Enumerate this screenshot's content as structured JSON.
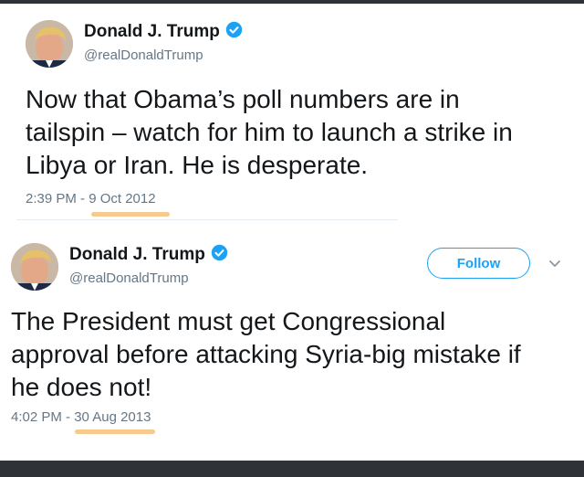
{
  "tweets": [
    {
      "author_name": "Donald J. Trump",
      "handle": "@realDonaldTrump",
      "text_lines": [
        "Now that Obama’s poll numbers are in",
        "tailspin – watch for him to launch a strike in",
        "Libya or Iran.  He is desperate."
      ],
      "timestamp": "2:39 PM - 9 Oct 2012"
    },
    {
      "author_name": "Donald J. Trump",
      "handle": "@realDonaldTrump",
      "follow_label": "Follow",
      "text_lines": [
        "The President must get Congressional",
        "approval before attacking Syria-big mistake if",
        "he does not!"
      ],
      "timestamp": "4:02 PM - 30 Aug 2013"
    }
  ],
  "icons": {
    "verified": "verified-badge-icon",
    "chevron": "chevron-down-icon"
  },
  "colors": {
    "text": "#14171a",
    "secondary": "#657786",
    "accent": "#1da1f2",
    "highlight": "#f5c07a"
  }
}
